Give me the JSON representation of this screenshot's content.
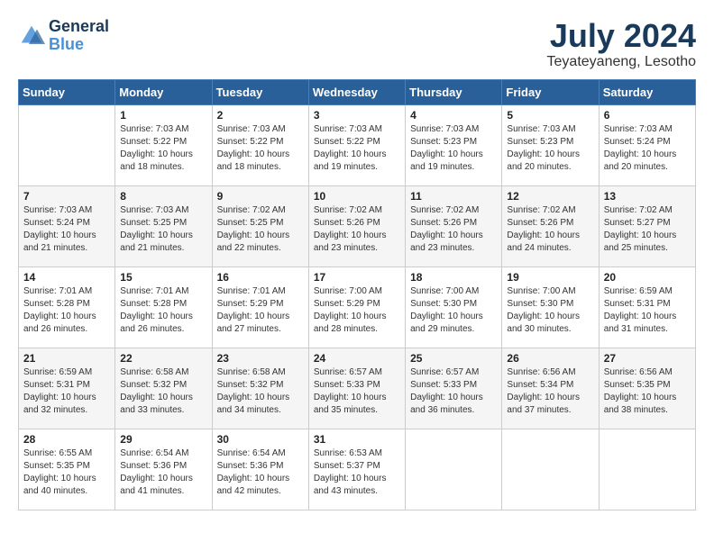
{
  "logo": {
    "line1": "General",
    "line2": "Blue"
  },
  "title": {
    "month": "July 2024",
    "location": "Teyateyaneng, Lesotho"
  },
  "weekdays": [
    "Sunday",
    "Monday",
    "Tuesday",
    "Wednesday",
    "Thursday",
    "Friday",
    "Saturday"
  ],
  "weeks": [
    [
      {
        "day": "",
        "info": ""
      },
      {
        "day": "1",
        "info": "Sunrise: 7:03 AM\nSunset: 5:22 PM\nDaylight: 10 hours\nand 18 minutes."
      },
      {
        "day": "2",
        "info": "Sunrise: 7:03 AM\nSunset: 5:22 PM\nDaylight: 10 hours\nand 18 minutes."
      },
      {
        "day": "3",
        "info": "Sunrise: 7:03 AM\nSunset: 5:22 PM\nDaylight: 10 hours\nand 19 minutes."
      },
      {
        "day": "4",
        "info": "Sunrise: 7:03 AM\nSunset: 5:23 PM\nDaylight: 10 hours\nand 19 minutes."
      },
      {
        "day": "5",
        "info": "Sunrise: 7:03 AM\nSunset: 5:23 PM\nDaylight: 10 hours\nand 20 minutes."
      },
      {
        "day": "6",
        "info": "Sunrise: 7:03 AM\nSunset: 5:24 PM\nDaylight: 10 hours\nand 20 minutes."
      }
    ],
    [
      {
        "day": "7",
        "info": "Sunrise: 7:03 AM\nSunset: 5:24 PM\nDaylight: 10 hours\nand 21 minutes."
      },
      {
        "day": "8",
        "info": "Sunrise: 7:03 AM\nSunset: 5:25 PM\nDaylight: 10 hours\nand 21 minutes."
      },
      {
        "day": "9",
        "info": "Sunrise: 7:02 AM\nSunset: 5:25 PM\nDaylight: 10 hours\nand 22 minutes."
      },
      {
        "day": "10",
        "info": "Sunrise: 7:02 AM\nSunset: 5:26 PM\nDaylight: 10 hours\nand 23 minutes."
      },
      {
        "day": "11",
        "info": "Sunrise: 7:02 AM\nSunset: 5:26 PM\nDaylight: 10 hours\nand 23 minutes."
      },
      {
        "day": "12",
        "info": "Sunrise: 7:02 AM\nSunset: 5:26 PM\nDaylight: 10 hours\nand 24 minutes."
      },
      {
        "day": "13",
        "info": "Sunrise: 7:02 AM\nSunset: 5:27 PM\nDaylight: 10 hours\nand 25 minutes."
      }
    ],
    [
      {
        "day": "14",
        "info": "Sunrise: 7:01 AM\nSunset: 5:28 PM\nDaylight: 10 hours\nand 26 minutes."
      },
      {
        "day": "15",
        "info": "Sunrise: 7:01 AM\nSunset: 5:28 PM\nDaylight: 10 hours\nand 26 minutes."
      },
      {
        "day": "16",
        "info": "Sunrise: 7:01 AM\nSunset: 5:29 PM\nDaylight: 10 hours\nand 27 minutes."
      },
      {
        "day": "17",
        "info": "Sunrise: 7:00 AM\nSunset: 5:29 PM\nDaylight: 10 hours\nand 28 minutes."
      },
      {
        "day": "18",
        "info": "Sunrise: 7:00 AM\nSunset: 5:30 PM\nDaylight: 10 hours\nand 29 minutes."
      },
      {
        "day": "19",
        "info": "Sunrise: 7:00 AM\nSunset: 5:30 PM\nDaylight: 10 hours\nand 30 minutes."
      },
      {
        "day": "20",
        "info": "Sunrise: 6:59 AM\nSunset: 5:31 PM\nDaylight: 10 hours\nand 31 minutes."
      }
    ],
    [
      {
        "day": "21",
        "info": "Sunrise: 6:59 AM\nSunset: 5:31 PM\nDaylight: 10 hours\nand 32 minutes."
      },
      {
        "day": "22",
        "info": "Sunrise: 6:58 AM\nSunset: 5:32 PM\nDaylight: 10 hours\nand 33 minutes."
      },
      {
        "day": "23",
        "info": "Sunrise: 6:58 AM\nSunset: 5:32 PM\nDaylight: 10 hours\nand 34 minutes."
      },
      {
        "day": "24",
        "info": "Sunrise: 6:57 AM\nSunset: 5:33 PM\nDaylight: 10 hours\nand 35 minutes."
      },
      {
        "day": "25",
        "info": "Sunrise: 6:57 AM\nSunset: 5:33 PM\nDaylight: 10 hours\nand 36 minutes."
      },
      {
        "day": "26",
        "info": "Sunrise: 6:56 AM\nSunset: 5:34 PM\nDaylight: 10 hours\nand 37 minutes."
      },
      {
        "day": "27",
        "info": "Sunrise: 6:56 AM\nSunset: 5:35 PM\nDaylight: 10 hours\nand 38 minutes."
      }
    ],
    [
      {
        "day": "28",
        "info": "Sunrise: 6:55 AM\nSunset: 5:35 PM\nDaylight: 10 hours\nand 40 minutes."
      },
      {
        "day": "29",
        "info": "Sunrise: 6:54 AM\nSunset: 5:36 PM\nDaylight: 10 hours\nand 41 minutes."
      },
      {
        "day": "30",
        "info": "Sunrise: 6:54 AM\nSunset: 5:36 PM\nDaylight: 10 hours\nand 42 minutes."
      },
      {
        "day": "31",
        "info": "Sunrise: 6:53 AM\nSunset: 5:37 PM\nDaylight: 10 hours\nand 43 minutes."
      },
      {
        "day": "",
        "info": ""
      },
      {
        "day": "",
        "info": ""
      },
      {
        "day": "",
        "info": ""
      }
    ]
  ]
}
